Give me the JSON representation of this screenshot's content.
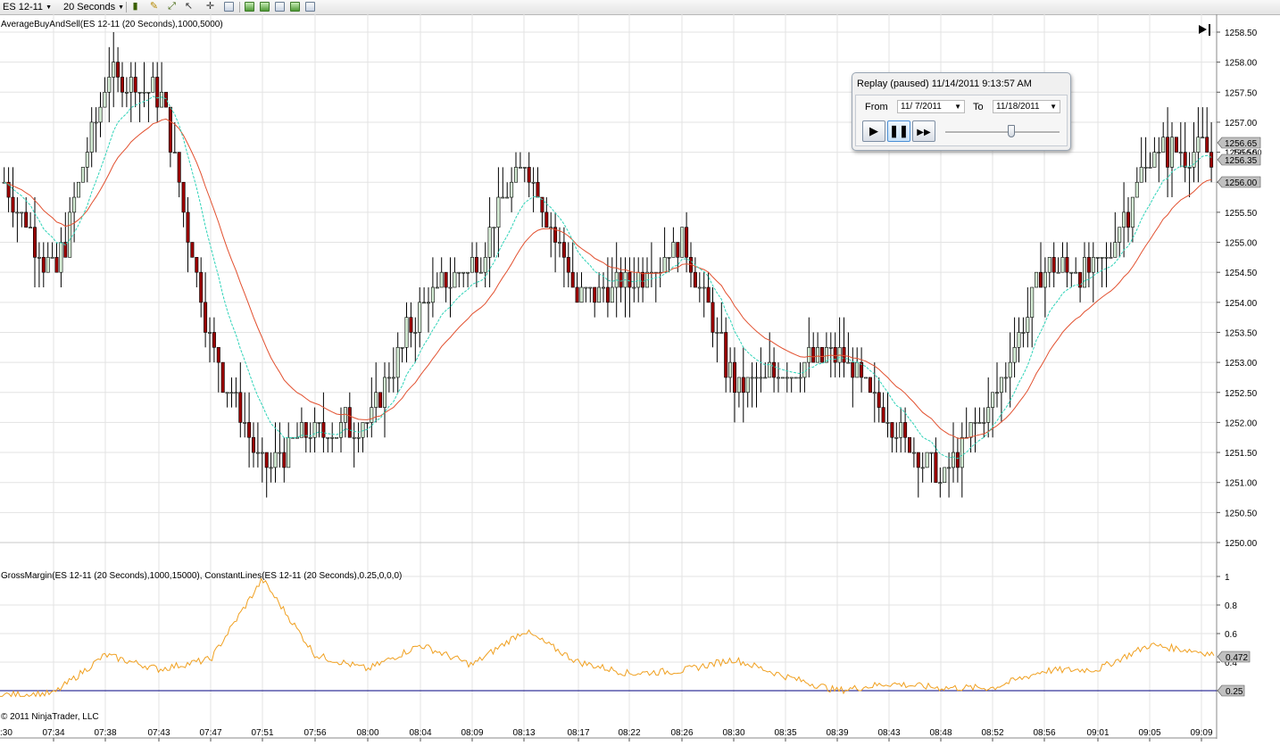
{
  "toolbar": {
    "instrument": "ES 12-11",
    "interval": "20 Seconds"
  },
  "price_panel": {
    "indicator_label": "AverageBuyAndSell(ES 12-11 (20 Seconds),1000,5000)",
    "y_axis_labels": [
      "1258.50",
      "1258.00",
      "1257.50",
      "1257.00",
      "1256.50",
      "1256.00",
      "1255.50",
      "1255.00",
      "1254.50",
      "1254.00",
      "1253.50",
      "1253.00",
      "1252.50",
      "1252.00",
      "1251.50",
      "1251.00",
      "1250.50",
      "1250.00"
    ],
    "price_markers": [
      "1256.65",
      "1256.35",
      "1256.00"
    ],
    "partial_label": "1256.50"
  },
  "indicator_panel": {
    "indicator_label": "GrossMargin(ES 12-11 (20 Seconds),1000,15000), ConstantLines(ES 12-11 (20 Seconds),0.25,0,0,0)",
    "y_axis_labels": [
      "1",
      "0.8",
      "0.6",
      "0.4",
      "0.2"
    ],
    "value_marker": "0.472",
    "line_marker": "0.25",
    "copyright": "© 2011 NinjaTrader, LLC"
  },
  "time_axis": {
    "labels": [
      "07:34",
      "07:38",
      "07:43",
      "07:47",
      "07:51",
      "07:56",
      "08:00",
      "08:04",
      "08:09",
      "08:13",
      "08:17",
      "08:22",
      "08:26",
      "08:30",
      "08:35",
      "08:39",
      "08:43",
      "08:48",
      "08:52",
      "08:56",
      "09:01",
      "09:05",
      "09:09"
    ],
    "partial_left": ":30"
  },
  "replay": {
    "title": "Replay (paused) 11/14/2011 9:13:57 AM",
    "from_label": "From",
    "from_value": "11/ 7/2011",
    "to_label": "To",
    "to_value": "11/18/2011",
    "play_icon": "play-icon",
    "pause_icon": "pause-icon",
    "fast_forward_icon": "fast-forward-icon",
    "speed_slider_position": 0.58
  },
  "colors": {
    "up_candle": "#d4ecd4",
    "down_candle": "#9b0000",
    "fast_average": "#2ed3b8",
    "slow_average": "#e2502f",
    "gross_margin_line": "#f0a020",
    "constant_line": "#000080",
    "grid": "#e3e3e3"
  },
  "chart_data": [
    {
      "type": "candlestick",
      "title": "AverageBuyAndSell(ES 12-11 (20 Seconds),1000,5000)",
      "ylim": [
        1250.0,
        1258.5
      ],
      "x": [
        "07:34",
        "07:38",
        "07:43",
        "07:47",
        "07:51",
        "07:56",
        "08:00",
        "08:04",
        "08:09",
        "08:13",
        "08:17",
        "08:22",
        "08:26",
        "08:30",
        "08:35",
        "08:39",
        "08:43",
        "08:48",
        "08:52",
        "08:56",
        "09:01",
        "09:05",
        "09:09"
      ],
      "series": [
        {
          "name": "close (approx. every ~20 bars)",
          "values": [
            1254.4,
            1257.8,
            1257.5,
            1253.2,
            1251.2,
            1251.9,
            1252.0,
            1254.0,
            1254.6,
            1256.4,
            1254.0,
            1254.4,
            1255.0,
            1252.5,
            1252.9,
            1253.2,
            1252.0,
            1251.0,
            1252.4,
            1254.6,
            1254.5,
            1256.5,
            1256.5
          ]
        }
      ]
    },
    {
      "type": "line",
      "title": "GrossMargin(ES 12-11 (20 Seconds),1000,15000)",
      "ylim": [
        0.15,
        1.0
      ],
      "x": [
        "07:34",
        "07:38",
        "07:43",
        "07:47",
        "07:51",
        "07:56",
        "08:00",
        "08:04",
        "08:09",
        "08:13",
        "08:17",
        "08:22",
        "08:26",
        "08:30",
        "08:35",
        "08:39",
        "08:43",
        "08:48",
        "08:52",
        "08:56",
        "09:01",
        "09:05",
        "09:09"
      ],
      "series": [
        {
          "name": "GrossMargin",
          "values": [
            0.18,
            0.45,
            0.35,
            0.42,
            0.98,
            0.45,
            0.35,
            0.52,
            0.38,
            0.62,
            0.4,
            0.32,
            0.34,
            0.42,
            0.3,
            0.2,
            0.25,
            0.22,
            0.22,
            0.34,
            0.35,
            0.52,
            0.472
          ]
        },
        {
          "name": "ConstantLines",
          "values": [
            0.25,
            0.25,
            0.25,
            0.25,
            0.25,
            0.25,
            0.25,
            0.25,
            0.25,
            0.25,
            0.25,
            0.25,
            0.25,
            0.25,
            0.25,
            0.25,
            0.25,
            0.25,
            0.25,
            0.25,
            0.25,
            0.25,
            0.25
          ]
        }
      ]
    }
  ]
}
